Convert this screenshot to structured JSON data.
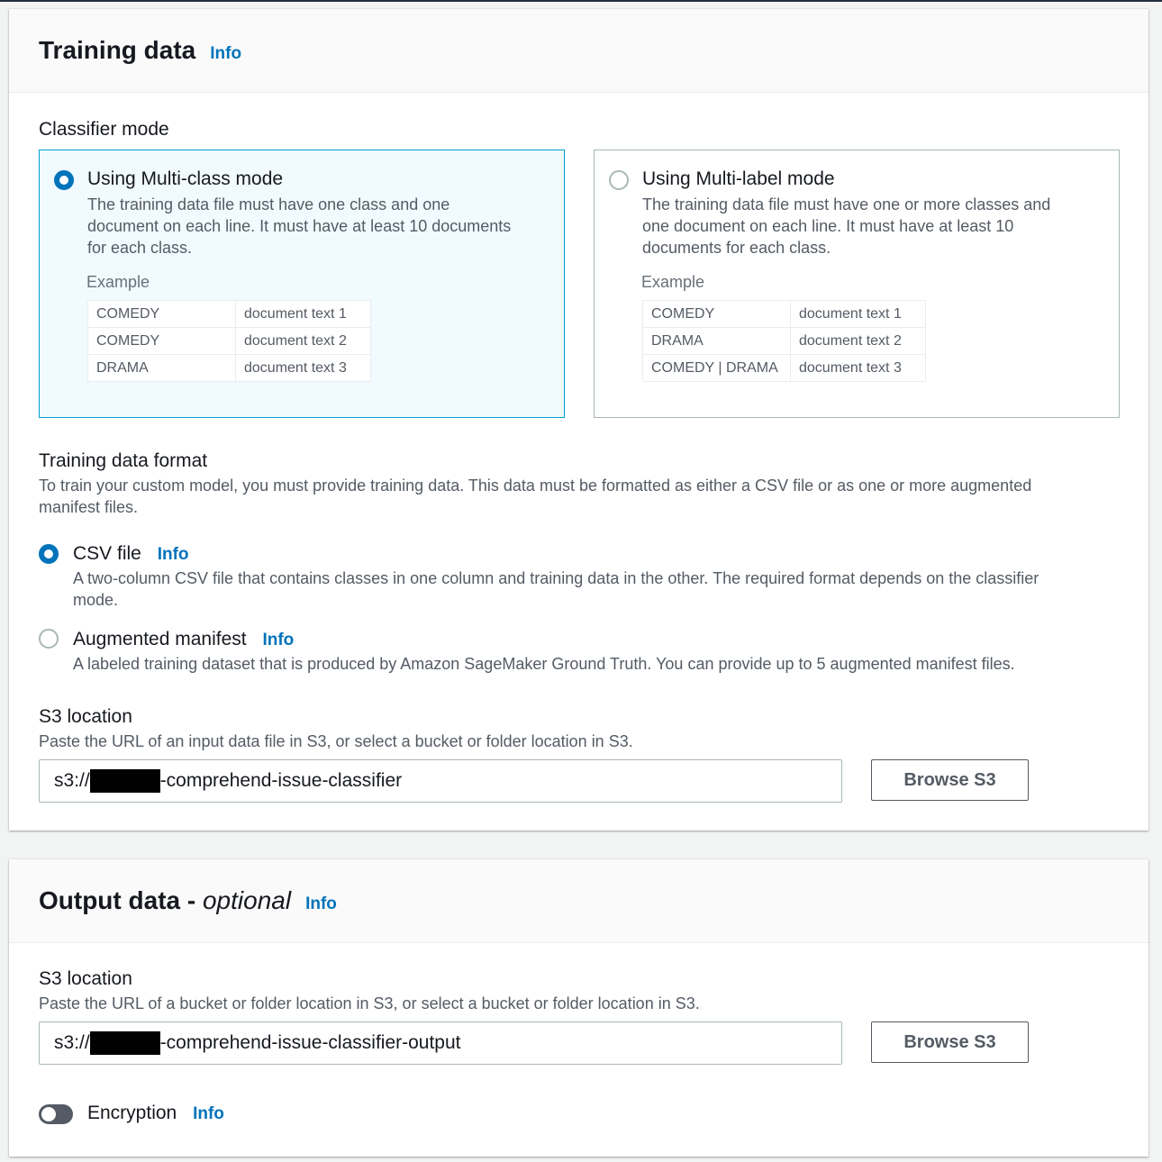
{
  "training": {
    "title": "Training data",
    "info": "Info",
    "classifier_mode_label": "Classifier mode",
    "multiclass": {
      "title": "Using Multi-class mode",
      "desc_lines": [
        "The training data file must have one class and one",
        "document on each line. It must have at least 10 documents",
        "for each class."
      ],
      "example_label": "Example",
      "rows": [
        [
          "COMEDY",
          "document text 1"
        ],
        [
          "COMEDY",
          "document text 2"
        ],
        [
          "DRAMA",
          "document text 3"
        ]
      ],
      "selected": true
    },
    "multilabel": {
      "title": "Using Multi-label mode",
      "desc_lines": [
        "The training data file must have one or more classes and",
        "one document on each line. It must have at least 10",
        "documents for each class."
      ],
      "example_label": "Example",
      "rows": [
        [
          "COMEDY",
          "document text 1"
        ],
        [
          "DRAMA",
          "document text 2"
        ],
        [
          "COMEDY | DRAMA",
          "document text 3"
        ]
      ],
      "selected": false
    },
    "format_label": "Training data format",
    "format_desc_lines": [
      "To train your custom model, you must provide training data. This data must be formatted as either a CSV file or as one or more augmented",
      "manifest files."
    ],
    "csv": {
      "label": "CSV file",
      "info": "Info",
      "desc_lines": [
        "A two-column CSV file that contains classes in one column and training data in the other. The required format depends on the classifier",
        "mode."
      ],
      "selected": true
    },
    "manifest": {
      "label": "Augmented manifest",
      "info": "Info",
      "desc": "A labeled training dataset that is produced by Amazon SageMaker Ground Truth. You can provide up to 5 augmented manifest files.",
      "selected": false
    },
    "s3_label": "S3 location",
    "s3_desc": "Paste the URL of an input data file in S3, or select a bucket or folder location in S3.",
    "s3_prefix": "s3://",
    "s3_suffix": "-comprehend-issue-classifier",
    "browse": "Browse S3"
  },
  "output": {
    "title": "Output data - ",
    "title_optional": "optional",
    "info": "Info",
    "s3_label": "S3 location",
    "s3_desc": "Paste the URL of a bucket or folder location in S3, or select a bucket or folder location in S3.",
    "s3_prefix": "s3://",
    "s3_suffix": "-comprehend-issue-classifier-output",
    "browse": "Browse S3",
    "encryption_label": "Encryption",
    "encryption_info": "Info",
    "encryption_enabled": false
  }
}
